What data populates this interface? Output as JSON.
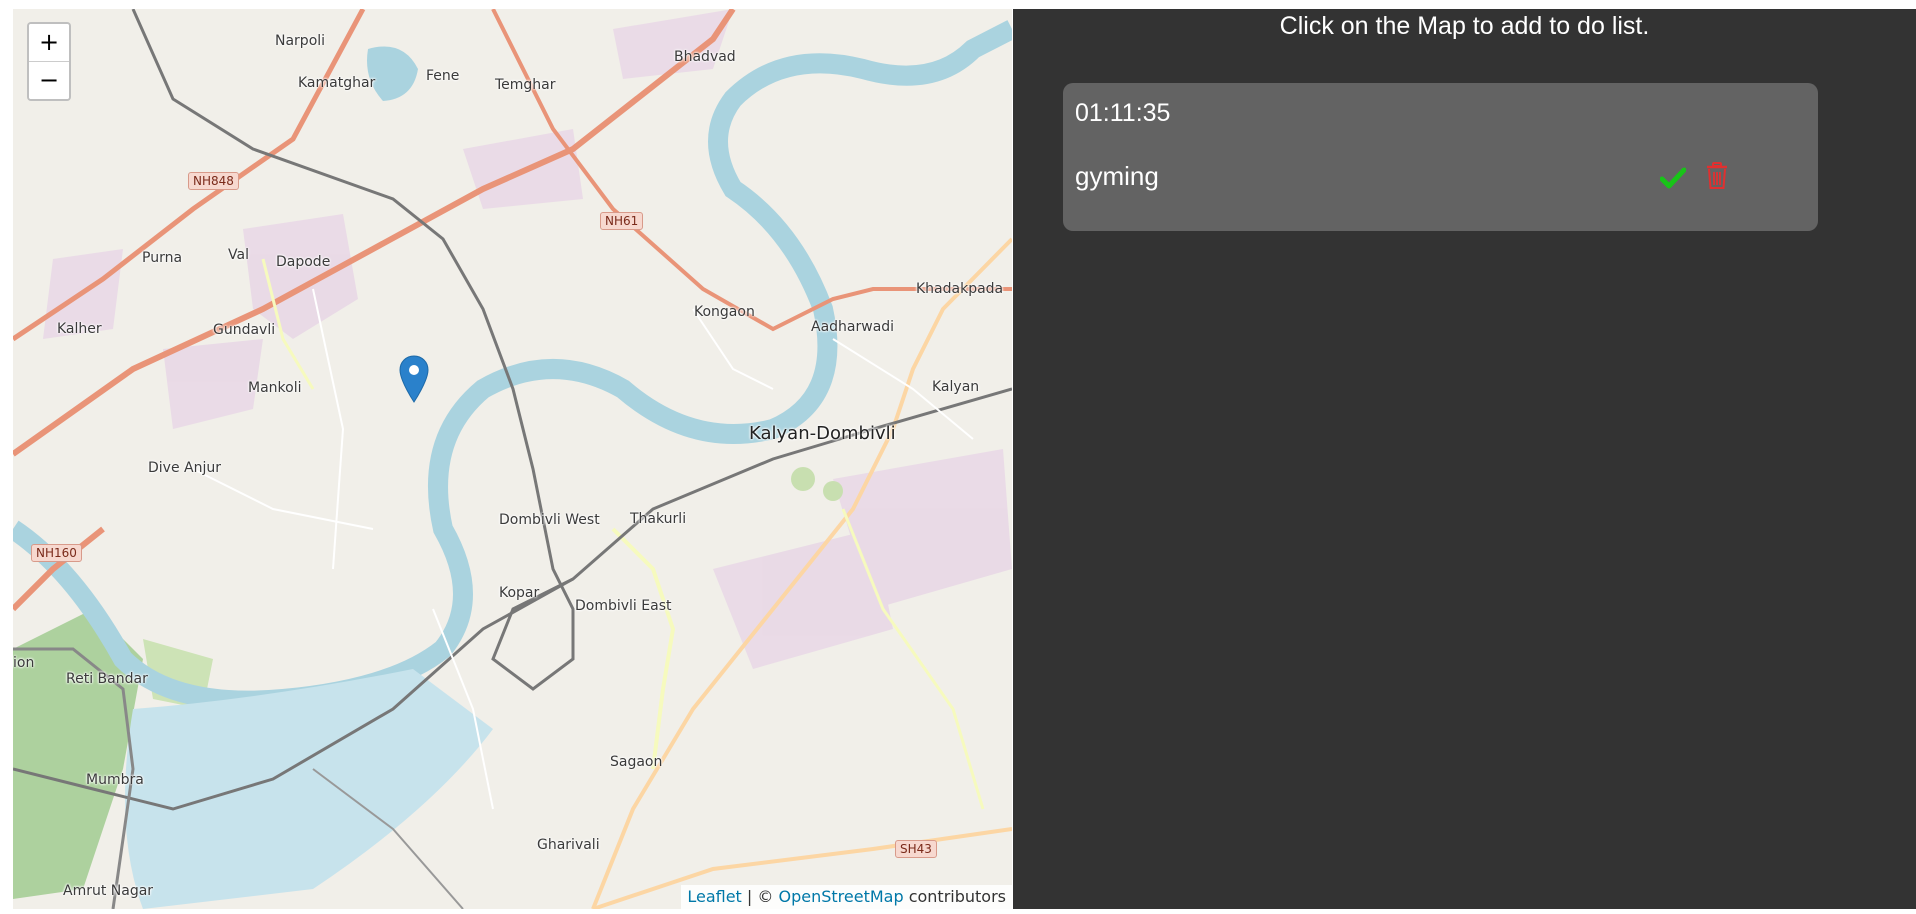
{
  "map": {
    "zoom_in": "+",
    "zoom_out": "−",
    "attribution": {
      "leaflet": "Leaflet",
      "separator": " | © ",
      "osm": "OpenStreetMap",
      "suffix": " contributors"
    },
    "labels": {
      "narpoli": "Narpoli",
      "kamatghar": "Kamatghar",
      "fene": "Fene",
      "temghar": "Temghar",
      "bhadvad": "Bhadvad",
      "purna": "Purna",
      "val": "Val",
      "dapode": "Dapode",
      "kalher": "Kalher",
      "gundavli": "Gundavli",
      "mankoli": "Mankoli",
      "dive_anjur": "Dive Anjur",
      "kongaon": "Kongaon",
      "aadharwadi": "Aadharwadi",
      "khadakpada": "Khadakpada",
      "kalyan": "Kalyan",
      "kalyan_dombivli": "Kalyan-Dombivli",
      "dombivli_west": "Dombivli West",
      "thakurli": "Thakurli",
      "kopar": "Kopar",
      "dombivli_east": "Dombivli East",
      "reti_bandar": "Reti Bandar",
      "mumbra": "Mumbra",
      "sagaon": "Sagaon",
      "gharivali": "Gharivali",
      "amrut_nagar": "Amrut Nagar",
      "ion": "ion"
    },
    "shields": {
      "nh848": "NH848",
      "nh61": "NH61",
      "nh160": "NH160",
      "sh43": "SH43"
    },
    "marker_icon": "map-pin-icon",
    "colors": {
      "water": "#aad3df",
      "motorway": "#e99478",
      "primary": "#fcd6a4",
      "land": "#f1efe9"
    }
  },
  "sidebar": {
    "instruction": "Click on the Map to add to do list.",
    "todos": [
      {
        "time": "01:11:35",
        "task": "gyming",
        "done_icon": "check-icon",
        "delete_icon": "trash-icon"
      }
    ],
    "colors": {
      "background": "#333333",
      "card": "#636363",
      "done": "#18c418",
      "delete": "#e03030"
    }
  }
}
